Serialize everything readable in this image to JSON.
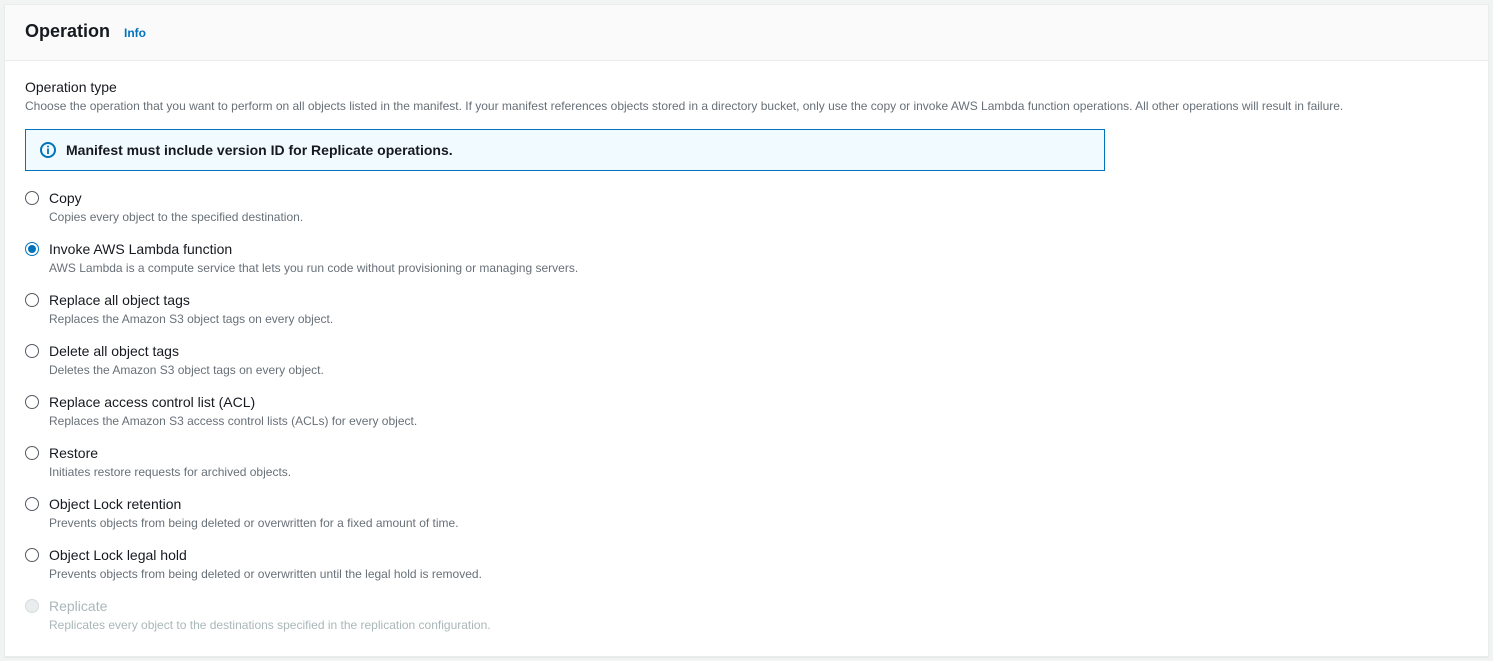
{
  "panel": {
    "title": "Operation",
    "info": "Info"
  },
  "section": {
    "label": "Operation type",
    "description": "Choose the operation that you want to perform on all objects listed in the manifest. If your manifest references objects stored in a directory bucket, only use the copy or invoke AWS Lambda function operations. All other operations will result in failure."
  },
  "alert": {
    "message": "Manifest must include version ID for Replicate operations."
  },
  "options": [
    {
      "label": "Copy",
      "description": "Copies every object to the specified destination.",
      "selected": false,
      "disabled": false
    },
    {
      "label": "Invoke AWS Lambda function",
      "description": "AWS Lambda is a compute service that lets you run code without provisioning or managing servers.",
      "selected": true,
      "disabled": false
    },
    {
      "label": "Replace all object tags",
      "description": "Replaces the Amazon S3 object tags on every object.",
      "selected": false,
      "disabled": false
    },
    {
      "label": "Delete all object tags",
      "description": "Deletes the Amazon S3 object tags on every object.",
      "selected": false,
      "disabled": false
    },
    {
      "label": "Replace access control list (ACL)",
      "description": "Replaces the Amazon S3 access control lists (ACLs) for every object.",
      "selected": false,
      "disabled": false
    },
    {
      "label": "Restore",
      "description": "Initiates restore requests for archived objects.",
      "selected": false,
      "disabled": false
    },
    {
      "label": "Object Lock retention",
      "description": "Prevents objects from being deleted or overwritten for a fixed amount of time.",
      "selected": false,
      "disabled": false
    },
    {
      "label": "Object Lock legal hold",
      "description": "Prevents objects from being deleted or overwritten until the legal hold is removed.",
      "selected": false,
      "disabled": false
    },
    {
      "label": "Replicate",
      "description": "Replicates every object to the destinations specified in the replication configuration.",
      "selected": false,
      "disabled": true
    }
  ]
}
